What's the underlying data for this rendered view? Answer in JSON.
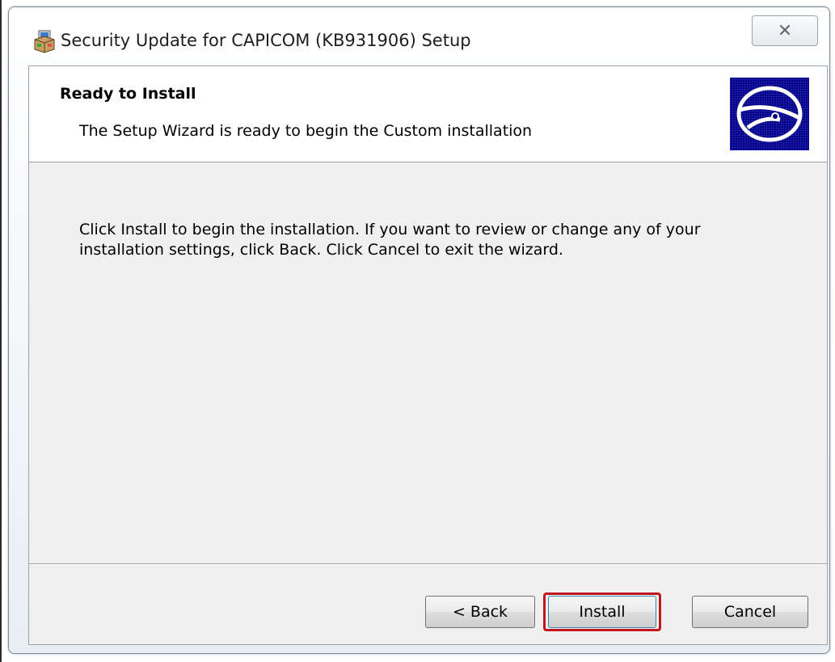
{
  "window": {
    "title": "Security Update for CAPICOM (KB931906) Setup",
    "close_icon": "close-icon",
    "app_icon": "installer-package-icon"
  },
  "banner": {
    "title": "Ready to Install",
    "subtitle": "The Setup Wizard is ready to begin the Custom installation",
    "image_icon": "disc-icon"
  },
  "body": {
    "line1": "Click Install to begin the installation. If you want to review or change any of your",
    "line2": "installation settings, click Back. Click Cancel to exit the wizard."
  },
  "buttons": {
    "back_label": "< Back",
    "install_label": "Install",
    "cancel_label": "Cancel"
  },
  "colors": {
    "highlight": "#c0161c",
    "banner_image_bg": "#00007a",
    "dialog_bg": "#f0f0f0"
  }
}
